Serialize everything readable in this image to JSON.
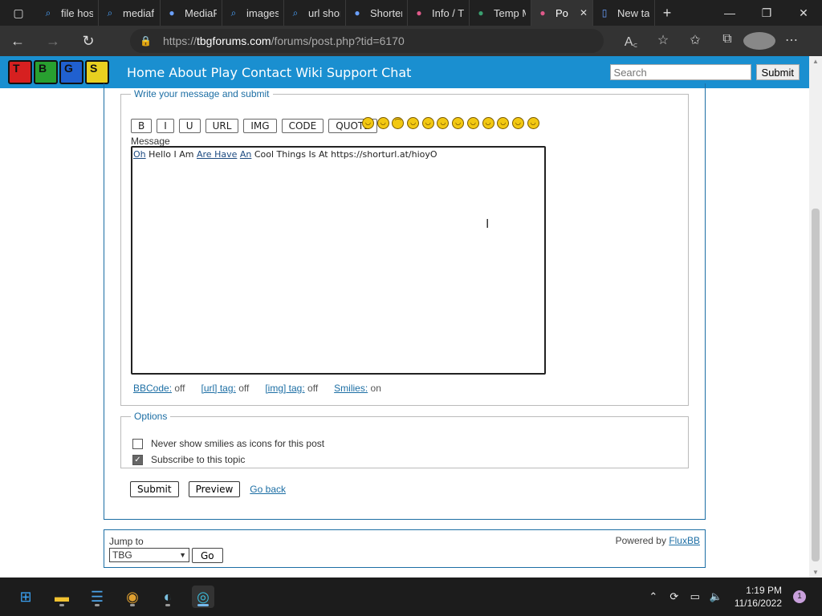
{
  "browser": {
    "tabs": [
      {
        "title": "file hos",
        "icon": "search-icon"
      },
      {
        "title": "mediaf",
        "icon": "search-icon"
      },
      {
        "title": "MediaF",
        "icon": "mediafire-icon"
      },
      {
        "title": "images",
        "icon": "search-icon"
      },
      {
        "title": "url shor",
        "icon": "search-icon"
      },
      {
        "title": "Shorter",
        "icon": "shorter-icon"
      },
      {
        "title": "Info / T",
        "icon": "tbg-icon"
      },
      {
        "title": "Temp M",
        "icon": "temp-mail-icon"
      },
      {
        "title": "Po",
        "icon": "tbg-icon",
        "active": true
      },
      {
        "title": "New ta",
        "icon": "page-icon"
      }
    ],
    "url_scheme": "https://",
    "url_host": "tbgforums.com",
    "url_path": "/forums/post.php?tid=6170"
  },
  "site": {
    "nav": [
      "Home",
      "About",
      "Play",
      "Contact",
      "Wiki",
      "Support",
      "Chat"
    ],
    "logo_letters": [
      "T",
      "B",
      "G",
      "S"
    ],
    "search_placeholder": "Search",
    "search_button": "Submit"
  },
  "post_form": {
    "legend": "Write your message and submit",
    "bbcode_buttons": [
      "B",
      "I",
      "U",
      "URL",
      "IMG",
      "CODE",
      "QUOTE"
    ],
    "smilies_count": 12,
    "message_label": "Message",
    "message_words": [
      {
        "t": "Oh",
        "u": true
      },
      {
        "t": " Hello I Am ",
        "u": false
      },
      {
        "t": "Are Have",
        "u": true
      },
      {
        "t": " ",
        "u": false
      },
      {
        "t": "An",
        "u": true
      },
      {
        "t": " Cool Things Is At https://shorturl.at/hioyO",
        "u": false
      }
    ],
    "bbinfo": [
      {
        "label": "BBCode:",
        "value": "off"
      },
      {
        "label": "[url] tag:",
        "value": "off"
      },
      {
        "label": "[img] tag:",
        "value": "off"
      },
      {
        "label": "Smilies:",
        "value": "on"
      }
    ]
  },
  "options": {
    "legend": "Options",
    "items": [
      {
        "label": "Never show smilies as icons for this post",
        "checked": false
      },
      {
        "label": "Subscribe to this topic",
        "checked": true
      }
    ]
  },
  "actions": {
    "submit": "Submit",
    "preview": "Preview",
    "go_back": "Go back"
  },
  "footer": {
    "jump_label": "Jump to",
    "jump_selected": "TBG",
    "go": "Go",
    "powered_prefix": "Powered by ",
    "powered_link": "FluxBB"
  },
  "taskbar": {
    "time": "1:19 PM",
    "date": "11/16/2022",
    "notifications": "1"
  }
}
